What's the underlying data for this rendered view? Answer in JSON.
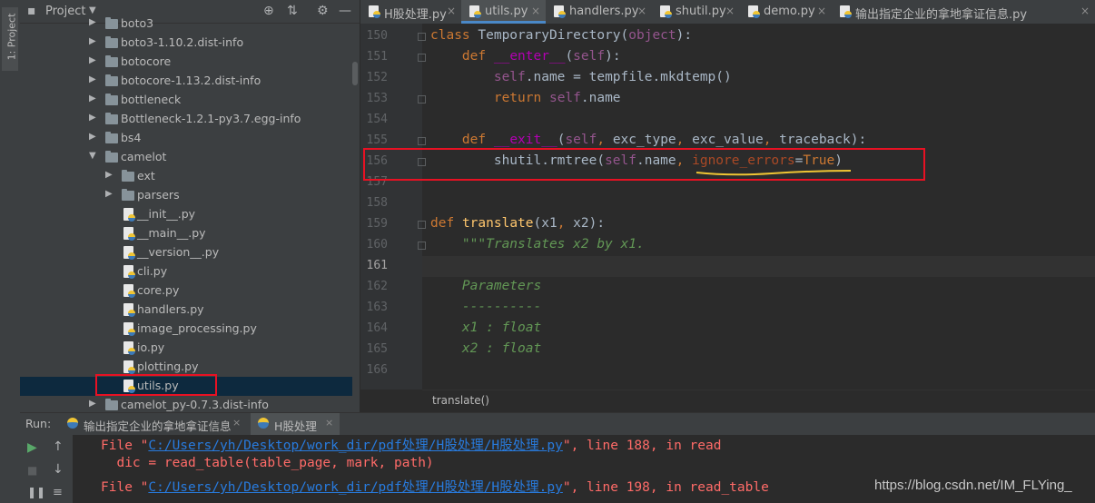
{
  "sidebar": {
    "project_label": "1: Project"
  },
  "project_panel": {
    "title": "Project",
    "items": [
      {
        "label": "boto3",
        "type": "folder",
        "depth": 0,
        "expanded": false
      },
      {
        "label": "boto3-1.10.2.dist-info",
        "type": "folder",
        "depth": 0,
        "expanded": false
      },
      {
        "label": "botocore",
        "type": "folder",
        "depth": 0,
        "expanded": false
      },
      {
        "label": "botocore-1.13.2.dist-info",
        "type": "folder",
        "depth": 0,
        "expanded": false
      },
      {
        "label": "bottleneck",
        "type": "folder",
        "depth": 0,
        "expanded": false
      },
      {
        "label": "Bottleneck-1.2.1-py3.7.egg-info",
        "type": "folder",
        "depth": 0,
        "expanded": false
      },
      {
        "label": "bs4",
        "type": "folder",
        "depth": 0,
        "expanded": false
      },
      {
        "label": "camelot",
        "type": "folder",
        "depth": 0,
        "expanded": true
      },
      {
        "label": "ext",
        "type": "folder",
        "depth": 1,
        "expanded": false
      },
      {
        "label": "parsers",
        "type": "folder",
        "depth": 1,
        "expanded": false
      },
      {
        "label": "__init__.py",
        "type": "file",
        "depth": 1
      },
      {
        "label": "__main__.py",
        "type": "file",
        "depth": 1
      },
      {
        "label": "__version__.py",
        "type": "file",
        "depth": 1
      },
      {
        "label": "cli.py",
        "type": "file",
        "depth": 1
      },
      {
        "label": "core.py",
        "type": "file",
        "depth": 1
      },
      {
        "label": "handlers.py",
        "type": "file",
        "depth": 1
      },
      {
        "label": "image_processing.py",
        "type": "file",
        "depth": 1
      },
      {
        "label": "io.py",
        "type": "file",
        "depth": 1
      },
      {
        "label": "plotting.py",
        "type": "file",
        "depth": 1
      },
      {
        "label": "utils.py",
        "type": "file",
        "depth": 1,
        "selected": true
      },
      {
        "label": "camelot_py-0.7.3.dist-info",
        "type": "folder",
        "depth": 0,
        "expanded": false
      }
    ]
  },
  "editor_tabs": [
    {
      "label": "H股处理.py",
      "active": false
    },
    {
      "label": "utils.py",
      "active": true
    },
    {
      "label": "handlers.py",
      "active": false
    },
    {
      "label": "shutil.py",
      "active": false
    },
    {
      "label": "demo.py",
      "active": false
    },
    {
      "label": "输出指定企业的拿地拿证信息.py",
      "active": false
    }
  ],
  "code": {
    "lines": [
      {
        "n": "150",
        "text": "class TemporaryDirectory(object):"
      },
      {
        "n": "151",
        "text": "    def __enter__(self):"
      },
      {
        "n": "152",
        "text": "        self.name = tempfile.mkdtemp()"
      },
      {
        "n": "153",
        "text": "        return self.name"
      },
      {
        "n": "154",
        "text": ""
      },
      {
        "n": "155",
        "text": "    def __exit__(self, exc_type, exc_value, traceback):"
      },
      {
        "n": "156",
        "text": "        shutil.rmtree(self.name, ignore_errors=True)"
      },
      {
        "n": "157",
        "text": ""
      },
      {
        "n": "158",
        "text": ""
      },
      {
        "n": "159",
        "text": "def translate(x1, x2):"
      },
      {
        "n": "160",
        "text": "    \"\"\"Translates x2 by x1."
      },
      {
        "n": "161",
        "text": ""
      },
      {
        "n": "162",
        "text": "    Parameters"
      },
      {
        "n": "163",
        "text": "    ----------"
      },
      {
        "n": "164",
        "text": "    x1 : float"
      },
      {
        "n": "165",
        "text": "    x2 : float"
      },
      {
        "n": "166",
        "text": ""
      }
    ],
    "current_line": "161",
    "highlighted_line": "156"
  },
  "breadcrumb": {
    "text": "translate()"
  },
  "run_panel": {
    "label": "Run:",
    "tabs": [
      {
        "label": "输出指定企业的拿地拿证信息",
        "active": false
      },
      {
        "label": "H股处理",
        "active": true
      }
    ],
    "output": [
      {
        "prefix": "File \"",
        "link": "C:/Users/yh/Desktop/work_dir/pdf处理/H股处理/H股处理.py",
        "suffix": "\", line 188, in read"
      },
      {
        "prefix": "  dic = read_table(table_page, mark, path)",
        "link": "",
        "suffix": ""
      },
      {
        "prefix": "File \"",
        "link": "C:/Users/yh/Desktop/work_dir/pdf处理/H股处理/H股处理.py",
        "suffix": "\", line 198, in read_table"
      }
    ]
  },
  "watermark": "https://blog.csdn.net/IM_FLYing_",
  "colors": {
    "keyword": "#cc7832",
    "self": "#94558d",
    "function": "#ffc66d",
    "docstring": "#629755",
    "error_text": "#ff6b68",
    "link": "#287bde",
    "annotation_box": "#e81123"
  }
}
